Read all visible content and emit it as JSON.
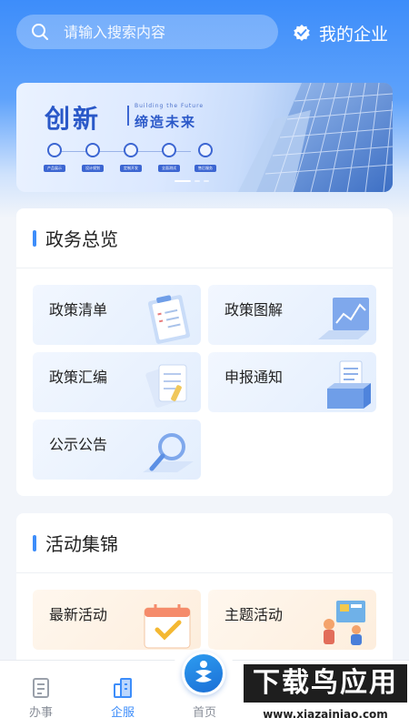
{
  "search": {
    "placeholder": "请输入搜索内容"
  },
  "header": {
    "my_company": "我的企业"
  },
  "banner": {
    "title": "创新",
    "subtitle_en": "Building the Future",
    "subtitle": "缔造未来",
    "tags": [
      "产品展示",
      "设计规划",
      "定制开发",
      "全面测试",
      "售后服务"
    ],
    "slide_count": 3,
    "active_slide": 1
  },
  "gov_card": {
    "title": "政务总览",
    "tiles": [
      "政策清单",
      "政策图解",
      "政策汇编",
      "申报通知",
      "公示公告"
    ]
  },
  "activity_card": {
    "title": "活动集锦",
    "tiles": [
      "最新活动",
      "主题活动"
    ]
  },
  "nav": {
    "items": [
      "办事",
      "企服",
      "首页"
    ],
    "active": "企服"
  },
  "watermark": {
    "text": "下载鸟应用",
    "url": "www.xiazainiao.com"
  },
  "colors": {
    "primary": "#3d8dfa",
    "banner_text": "#2a58c8"
  }
}
